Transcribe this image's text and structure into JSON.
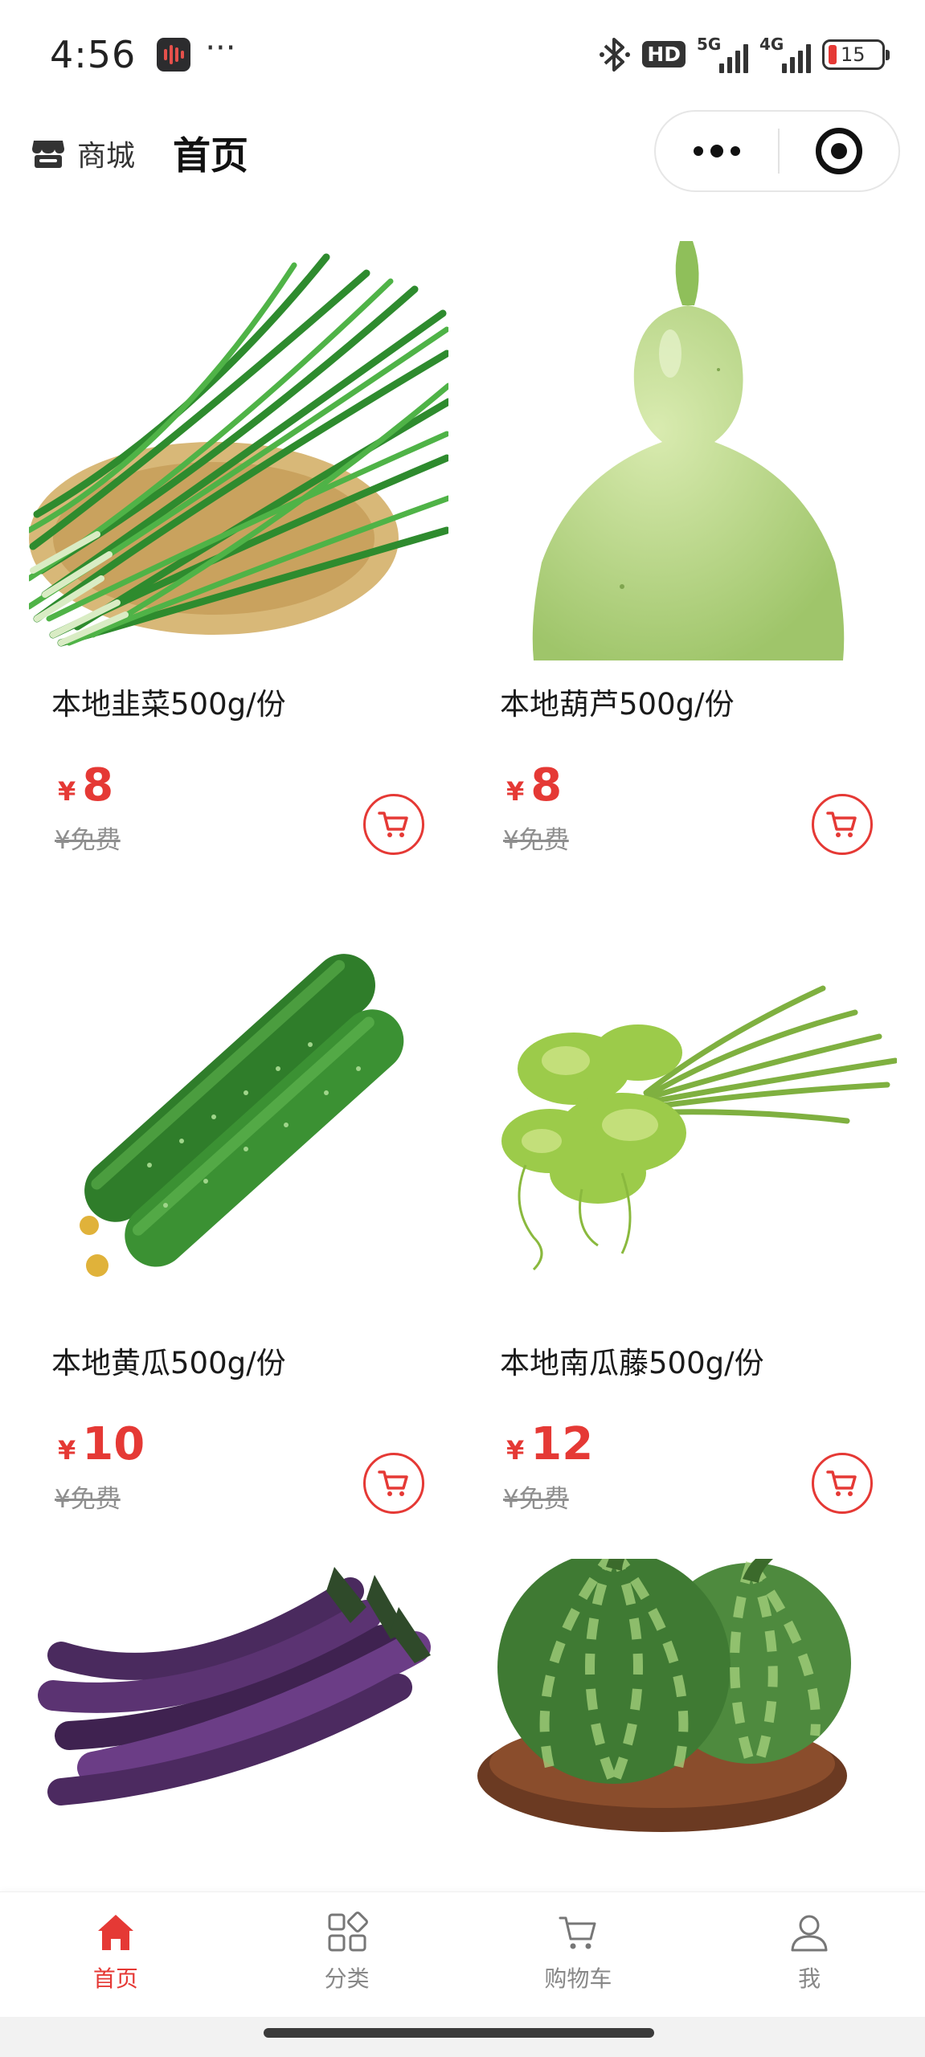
{
  "status_bar": {
    "time": "4:56",
    "more": "···",
    "hd_label": "HD",
    "net1": "5G",
    "net2": "4G",
    "battery": "15"
  },
  "nav": {
    "store_label": "商城",
    "title": "首页"
  },
  "accent_color": "#e53935",
  "products": [
    {
      "name": "本地韭菜500g/份",
      "currency": "¥",
      "price": "8",
      "original_price": "¥免费",
      "image": "chives"
    },
    {
      "name": "本地葫芦500g/份",
      "currency": "¥",
      "price": "8",
      "original_price": "¥免费",
      "image": "bottle-gourd"
    },
    {
      "name": "本地黄瓜500g/份",
      "currency": "¥",
      "price": "10",
      "original_price": "¥免费",
      "image": "cucumber"
    },
    {
      "name": "本地南瓜藤500g/份",
      "currency": "¥",
      "price": "12",
      "original_price": "¥免费",
      "image": "pumpkin-vine"
    },
    {
      "image": "eggplant"
    },
    {
      "image": "round-zucchini"
    }
  ],
  "tabs": [
    {
      "label": "首页",
      "icon": "home-icon",
      "active": true
    },
    {
      "label": "分类",
      "icon": "category-icon",
      "active": false
    },
    {
      "label": "购物车",
      "icon": "cart-icon",
      "active": false
    },
    {
      "label": "我",
      "icon": "user-icon",
      "active": false
    }
  ]
}
